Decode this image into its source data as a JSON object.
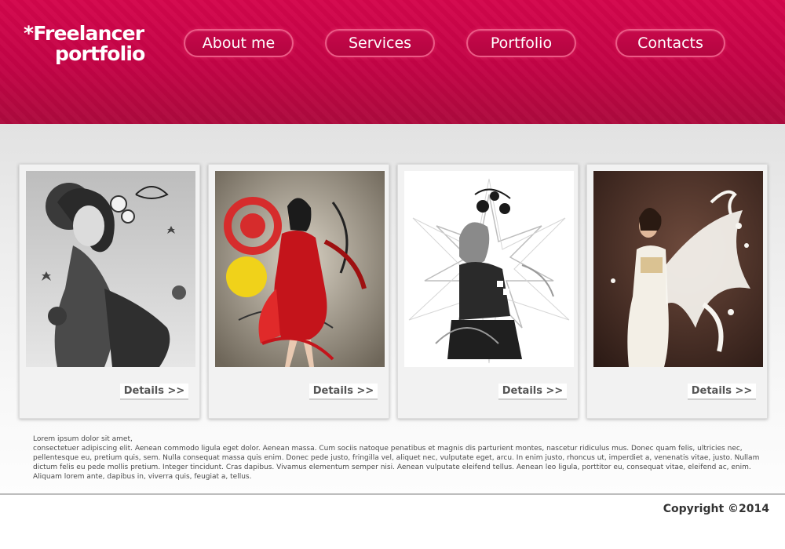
{
  "logo": {
    "line1": "*Freelancer",
    "line2": "portfolio"
  },
  "nav": [
    {
      "label": "About me"
    },
    {
      "label": "Services"
    },
    {
      "label": "Portfolio"
    },
    {
      "label": "Contacts"
    }
  ],
  "cards": [
    {
      "image": "grayscale-floral-woman-artwork",
      "details_label": "Details >>"
    },
    {
      "image": "red-dress-abstract-woman-artwork",
      "details_label": "Details >>"
    },
    {
      "image": "floral-splash-woman-artwork",
      "details_label": "Details >>"
    },
    {
      "image": "white-dress-milk-splash-artwork",
      "details_label": "Details >>"
    }
  ],
  "description": {
    "line1": "Lorem ipsum dolor sit amet,",
    "body": "consectetuer adipiscing elit. Aenean commodo ligula eget dolor. Aenean massa. Cum sociis natoque penatibus et magnis dis parturient montes, nascetur ridiculus mus. Donec quam felis, ultricies nec, pellentesque eu, pretium quis, sem. Nulla consequat massa quis enim. Donec pede justo, fringilla vel, aliquet nec, vulputate eget, arcu. In enim justo, rhoncus ut, imperdiet a, venenatis vitae, justo. Nullam dictum felis eu pede mollis pretium. Integer tincidunt. Cras dapibus. Vivamus elementum semper nisi. Aenean vulputate eleifend tellus. Aenean leo ligula, porttitor eu, consequat vitae, eleifend ac, enim. Aliquam lorem ante, dapibus in, viverra quis, feugiat a, tellus."
  },
  "footer": {
    "copyright": "Copyright ©2014"
  },
  "colors": {
    "brand": "#c30446",
    "nav_border": "#ec5a86",
    "text": "#4a4a4a"
  }
}
